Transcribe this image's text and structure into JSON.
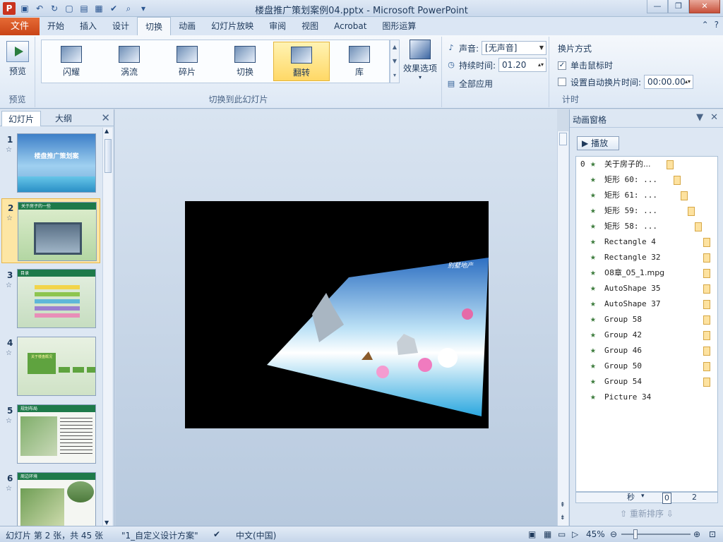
{
  "window": {
    "title": "楼盘推广策划案例04.pptx - Microsoft PowerPoint"
  },
  "tabs": {
    "file": "文件",
    "items": [
      "开始",
      "插入",
      "设计",
      "切换",
      "动画",
      "幻灯片放映",
      "审阅",
      "视图",
      "Acrobat",
      "图形运算"
    ],
    "active": "切换"
  },
  "ribbon": {
    "preview_label": "预览",
    "preview_group": "预览",
    "gallery": [
      "闪耀",
      "涡流",
      "碎片",
      "切换",
      "翻转",
      "库"
    ],
    "gallery_selected": "翻转",
    "effect_options": "效果选项",
    "transition_group": "切换到此幻灯片",
    "sound_label": "声音:",
    "sound_value": "[无声音]",
    "duration_label": "持续时间:",
    "duration_value": "01.20",
    "apply_all": "全部应用",
    "advance_title": "换片方式",
    "on_click": "单击鼠标时",
    "on_click_checked": true,
    "auto_after": "设置自动换片时间:",
    "auto_after_value": "00:00.00",
    "timing_group": "计时"
  },
  "left_panel": {
    "tab_slides": "幻灯片",
    "tab_outline": "大纲",
    "slides": [
      {
        "num": "1",
        "title": "楼盘推广策划案"
      },
      {
        "num": "2",
        "title": "关于房子的一些"
      },
      {
        "num": "3",
        "title": "目录"
      },
      {
        "num": "4",
        "title": "关于楼盘概况"
      },
      {
        "num": "5",
        "title": "规划布局"
      },
      {
        "num": "6",
        "title": "周边环境"
      }
    ],
    "selected": "2"
  },
  "anim_pane": {
    "title": "动画窗格",
    "play": "播放",
    "items": [
      {
        "num": "0",
        "label": "关于房子的..."
      },
      {
        "num": "",
        "label": "矩形 60: ..."
      },
      {
        "num": "",
        "label": "矩形 61: ..."
      },
      {
        "num": "",
        "label": "矩形 59: ..."
      },
      {
        "num": "",
        "label": "矩形 58: ..."
      },
      {
        "num": "",
        "label": "Rectangle 4"
      },
      {
        "num": "",
        "label": "Rectangle 32"
      },
      {
        "num": "",
        "label": "08章_05_1.mpg"
      },
      {
        "num": "",
        "label": "AutoShape 35"
      },
      {
        "num": "",
        "label": "AutoShape 37"
      },
      {
        "num": "",
        "label": "Group 58"
      },
      {
        "num": "",
        "label": "Group 42"
      },
      {
        "num": "",
        "label": "Group 46"
      },
      {
        "num": "",
        "label": "Group 50"
      },
      {
        "num": "",
        "label": "Group 54"
      },
      {
        "num": "",
        "label": "Picture 34"
      }
    ],
    "timeline_unit": "秒",
    "timeline_start": "0",
    "timeline_end": "2",
    "reorder": "重新排序"
  },
  "slide_text": {
    "corner": "别墅地产"
  },
  "status": {
    "slide_info": "幻灯片 第 2 张，共 45 张",
    "theme": "\"1_自定义设计方案\"",
    "language": "中文(中国)",
    "zoom": "45%"
  },
  "colors": {
    "file_tab": "#c94416",
    "selection": "#ffd866",
    "slide_bg": "#000000"
  }
}
